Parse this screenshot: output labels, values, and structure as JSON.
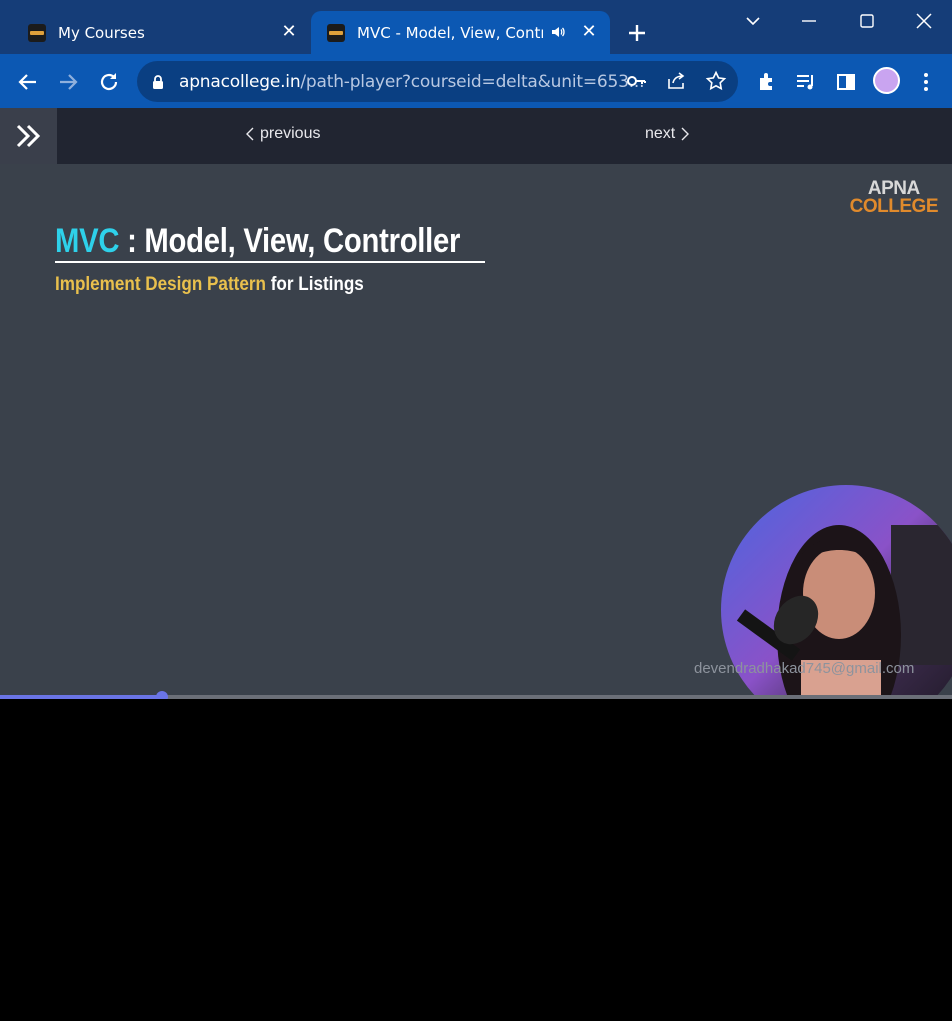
{
  "browser": {
    "tabs": [
      {
        "title": "My Courses",
        "active": false
      },
      {
        "title": "MVC - Model, View, Controller",
        "active": true
      }
    ],
    "url_host": "apnacollege.in",
    "url_rest": "/path-player?courseid=delta&unit=653...",
    "icons": [
      "back-icon",
      "forward-icon",
      "reload-icon",
      "lock-icon",
      "key-icon",
      "share-icon",
      "star-icon",
      "extensions-icon",
      "media-icon",
      "sidepanel-icon",
      "menu-icon"
    ]
  },
  "nav": {
    "previous_label": "previous",
    "next_label": "next"
  },
  "video": {
    "logo_line1": "APNA",
    "logo_line2": "COLLEGE",
    "title_highlight": "MVC",
    "title_rest": " : Model, View, Controller",
    "subtitle_highlight": "Implement Design Pattern",
    "subtitle_rest": " for Listings",
    "watermark": "devendradhakad745@gmail.com",
    "progress_fraction": 0.17
  },
  "colors": {
    "tabstrip": "#153d78",
    "toolbar": "#0c58b3",
    "accent_cyan": "#2ed1ea",
    "accent_yellow": "#e9c04d",
    "progress": "#6a74e6"
  }
}
